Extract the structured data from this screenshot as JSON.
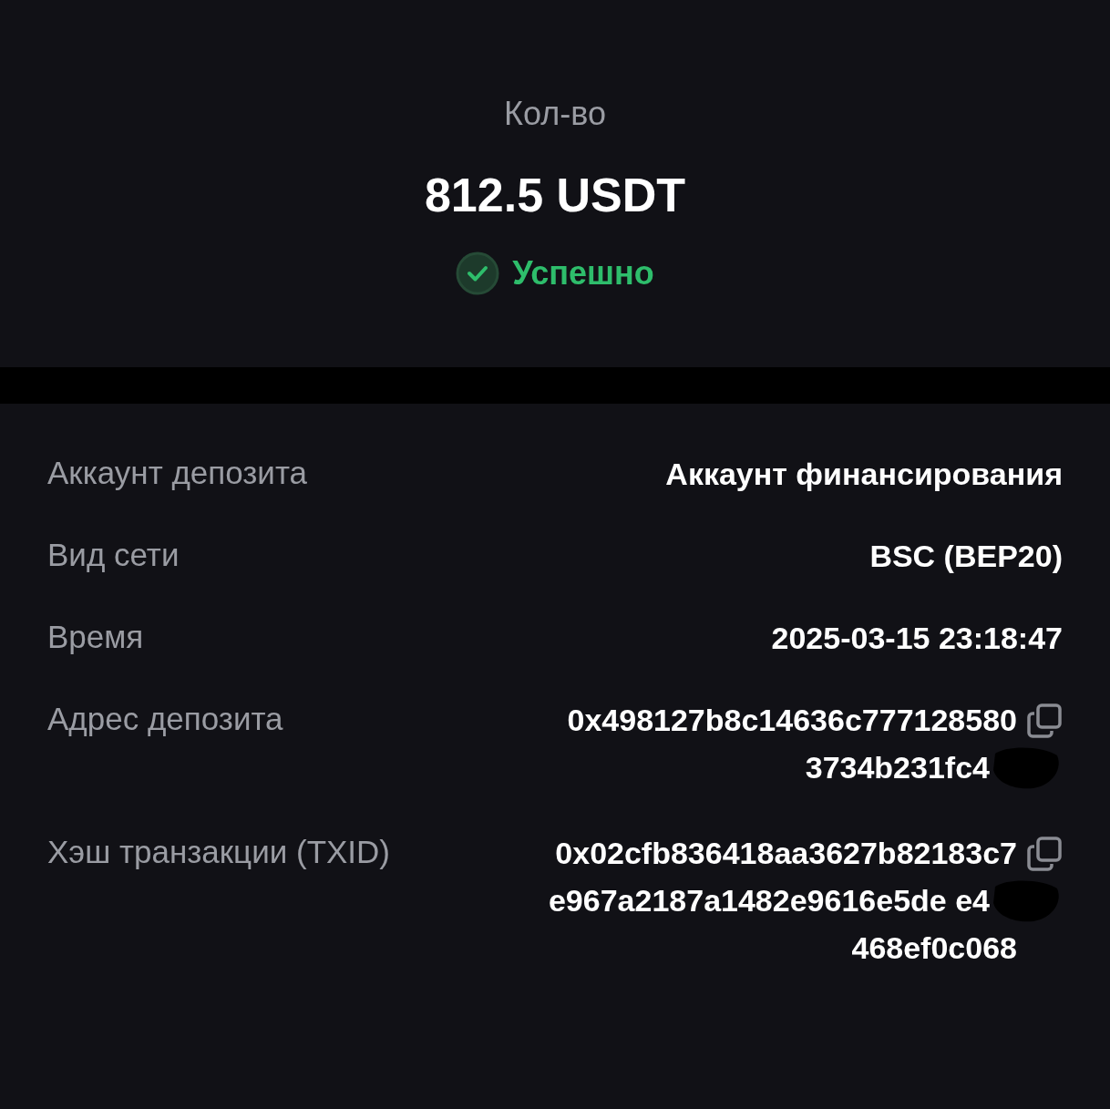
{
  "summary": {
    "label": "Кол-во",
    "amount": "812.5 USDT",
    "status": {
      "kind": "success",
      "text": "Успешно"
    }
  },
  "details": [
    {
      "label": "Аккаунт депозита",
      "kind": "text",
      "lines": [
        "Аккаунт финансирования"
      ]
    },
    {
      "label": "Вид сети",
      "kind": "text",
      "lines": [
        "BSC (BEP20)"
      ]
    },
    {
      "label": "Время",
      "kind": "text",
      "lines": [
        "2025-03-15 23:18:47"
      ]
    },
    {
      "label": "Адрес депозита",
      "kind": "copyable",
      "lines": [
        "0x498127b8c14636c777128580",
        "3734b231fc4"
      ]
    },
    {
      "label": "Хэш транзакции (TXID)",
      "kind": "copyable",
      "lines": [
        "0x02cfb836418aa3627b82183c7",
        "e967a2187a1482e9616e5de e4",
        "468ef0c068"
      ]
    }
  ]
}
